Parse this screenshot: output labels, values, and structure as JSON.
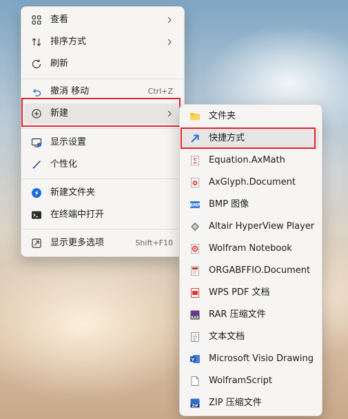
{
  "main_menu": {
    "items": [
      {
        "label": "查看",
        "icon": "grid-icon",
        "has_submenu": true
      },
      {
        "label": "排序方式",
        "icon": "sort-icon",
        "has_submenu": true
      },
      {
        "label": "刷新",
        "icon": "refresh-icon",
        "has_submenu": false
      },
      {
        "label": "撤消 移动",
        "icon": "undo-icon",
        "shortcut": "Ctrl+Z"
      },
      {
        "label": "新建",
        "icon": "add-circle-icon",
        "has_submenu": true,
        "highlighted": true
      },
      {
        "label": "显示设置",
        "icon": "display-settings-icon"
      },
      {
        "label": "个性化",
        "icon": "brush-icon"
      },
      {
        "label": "新建文件夹",
        "icon": "new-folder-icon"
      },
      {
        "label": "在终端中打开",
        "icon": "terminal-icon"
      },
      {
        "label": "显示更多选项",
        "icon": "more-options-icon",
        "shortcut": "Shift+F10"
      }
    ]
  },
  "new_submenu": {
    "items": [
      {
        "label": "文件夹",
        "icon": "folder-icon"
      },
      {
        "label": "快捷方式",
        "icon": "shortcut-arrow-icon",
        "highlighted": true
      },
      {
        "label": "Equation.AxMath",
        "icon": "axmath-icon"
      },
      {
        "label": "AxGlyph.Document",
        "icon": "axglyph-icon"
      },
      {
        "label": "BMP 图像",
        "icon": "bmp-icon"
      },
      {
        "label": "Altair HyperView Player",
        "icon": "hyperview-icon"
      },
      {
        "label": "Wolfram Notebook",
        "icon": "wolfram-notebook-icon"
      },
      {
        "label": "ORGABFFIO.Document",
        "icon": "orgabffio-icon"
      },
      {
        "label": "WPS PDF 文档",
        "icon": "wps-pdf-icon"
      },
      {
        "label": "RAR 压缩文件",
        "icon": "rar-icon"
      },
      {
        "label": "文本文档",
        "icon": "text-document-icon"
      },
      {
        "label": "Microsoft Visio Drawing",
        "icon": "visio-icon"
      },
      {
        "label": "WolframScript",
        "icon": "wolframscript-icon"
      },
      {
        "label": "ZIP 压缩文件",
        "icon": "zip-icon"
      }
    ]
  },
  "colors": {
    "accent_red": "#e0242f",
    "menu_bg": "#f6f5f4",
    "highlight_bg": "#e8e6e4"
  }
}
